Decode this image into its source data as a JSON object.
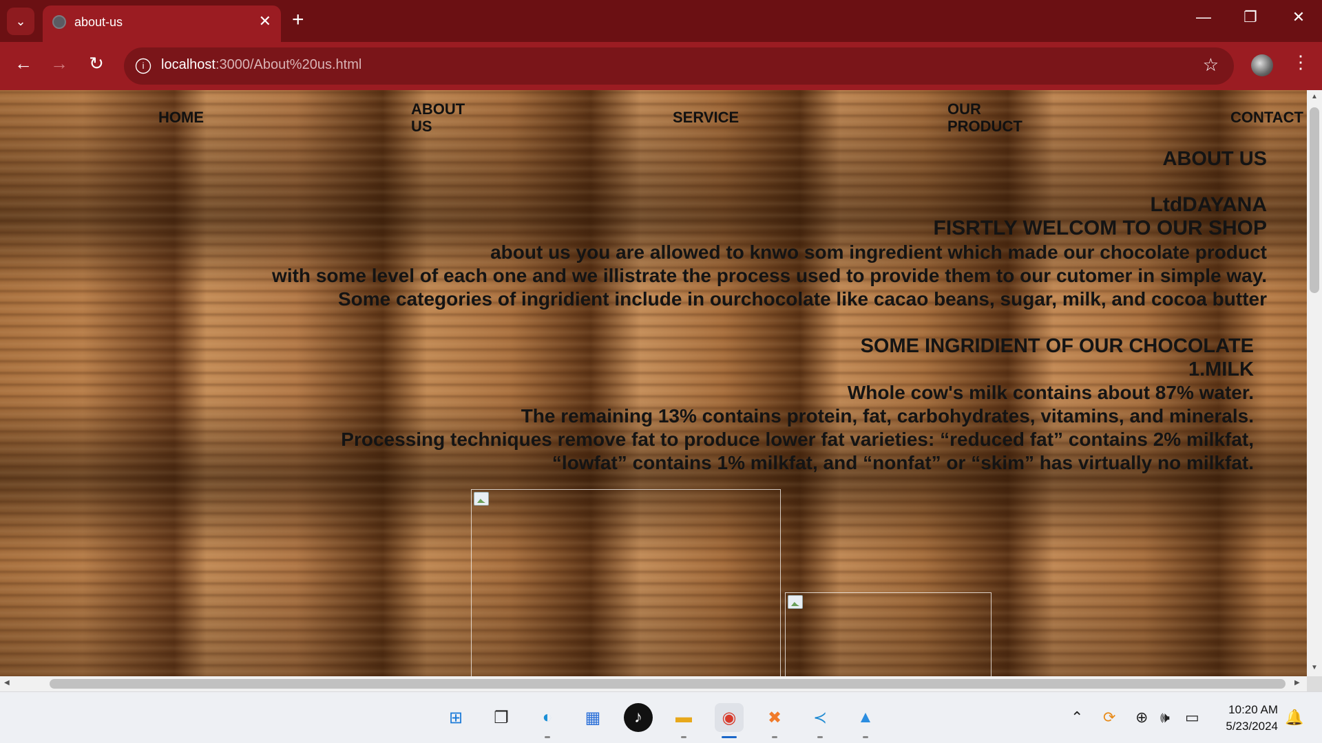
{
  "browser": {
    "tab_title": "about-us",
    "url_host": "localhost",
    "url_rest": ":3000/About%20us.html",
    "new_tab_label": "+",
    "close_tab_label": "✕"
  },
  "nav": {
    "home": "HOME",
    "about_line1": "ABOUT",
    "about_line2": "US",
    "service": "SERVICE",
    "product_line1": "OUR",
    "product_line2": "PRODUCT",
    "contact": "CONTACT"
  },
  "about": {
    "heading": "ABOUT US",
    "company": "LtdDAYANA",
    "welcome": "FISRTLY WELCOM TO OUR SHOP",
    "para_line1": "about us you are allowed to knwo som ingredient which made our chocolate product",
    "para_line2": "with some level of each one and we illistrate the process used to provide them to our cutomer in simple way.",
    "para_line3": "Some categories of ingridient include in ourchocolate like cacao beans, sugar, milk, and cocoa butter"
  },
  "ingredients": {
    "heading": "SOME INGRIDIENT OF OUR CHOCOLATE",
    "item1_title": "1.MILK",
    "line1": "Whole cow's milk contains about 87% water.",
    "line2": "The remaining 13% contains protein, fat, carbohydrates, vitamins, and minerals.",
    "line3": "Processing techniques remove fat to produce lower fat varieties: “reduced fat” contains 2% milkfat,",
    "line4": "“lowfat” contains 1% milkfat, and “nonfat” or “skim” has virtually no milkfat."
  },
  "taskbar": {
    "time": "10:20 AM",
    "date": "5/23/2024",
    "apps": [
      "windows-start",
      "task-view",
      "edge",
      "microsoft-store",
      "tiktok",
      "file-explorer",
      "chrome",
      "xampp",
      "vscode",
      "photos"
    ]
  }
}
